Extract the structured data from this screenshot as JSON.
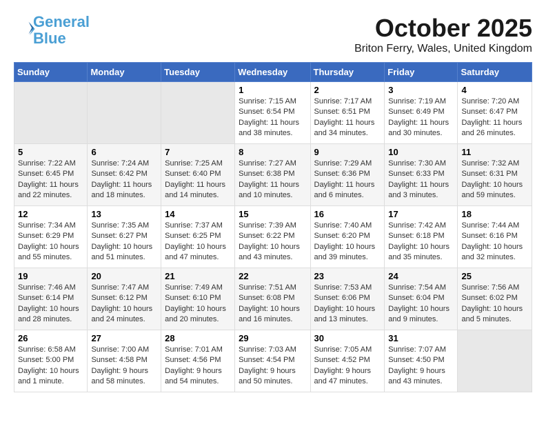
{
  "header": {
    "logo_line1": "General",
    "logo_line2": "Blue",
    "month": "October 2025",
    "location": "Briton Ferry, Wales, United Kingdom"
  },
  "days_of_week": [
    "Sunday",
    "Monday",
    "Tuesday",
    "Wednesday",
    "Thursday",
    "Friday",
    "Saturday"
  ],
  "weeks": [
    [
      {
        "day": "",
        "info": ""
      },
      {
        "day": "",
        "info": ""
      },
      {
        "day": "",
        "info": ""
      },
      {
        "day": "1",
        "info": "Sunrise: 7:15 AM\nSunset: 6:54 PM\nDaylight: 11 hours\nand 38 minutes."
      },
      {
        "day": "2",
        "info": "Sunrise: 7:17 AM\nSunset: 6:51 PM\nDaylight: 11 hours\nand 34 minutes."
      },
      {
        "day": "3",
        "info": "Sunrise: 7:19 AM\nSunset: 6:49 PM\nDaylight: 11 hours\nand 30 minutes."
      },
      {
        "day": "4",
        "info": "Sunrise: 7:20 AM\nSunset: 6:47 PM\nDaylight: 11 hours\nand 26 minutes."
      }
    ],
    [
      {
        "day": "5",
        "info": "Sunrise: 7:22 AM\nSunset: 6:45 PM\nDaylight: 11 hours\nand 22 minutes."
      },
      {
        "day": "6",
        "info": "Sunrise: 7:24 AM\nSunset: 6:42 PM\nDaylight: 11 hours\nand 18 minutes."
      },
      {
        "day": "7",
        "info": "Sunrise: 7:25 AM\nSunset: 6:40 PM\nDaylight: 11 hours\nand 14 minutes."
      },
      {
        "day": "8",
        "info": "Sunrise: 7:27 AM\nSunset: 6:38 PM\nDaylight: 11 hours\nand 10 minutes."
      },
      {
        "day": "9",
        "info": "Sunrise: 7:29 AM\nSunset: 6:36 PM\nDaylight: 11 hours\nand 6 minutes."
      },
      {
        "day": "10",
        "info": "Sunrise: 7:30 AM\nSunset: 6:33 PM\nDaylight: 11 hours\nand 3 minutes."
      },
      {
        "day": "11",
        "info": "Sunrise: 7:32 AM\nSunset: 6:31 PM\nDaylight: 10 hours\nand 59 minutes."
      }
    ],
    [
      {
        "day": "12",
        "info": "Sunrise: 7:34 AM\nSunset: 6:29 PM\nDaylight: 10 hours\nand 55 minutes."
      },
      {
        "day": "13",
        "info": "Sunrise: 7:35 AM\nSunset: 6:27 PM\nDaylight: 10 hours\nand 51 minutes."
      },
      {
        "day": "14",
        "info": "Sunrise: 7:37 AM\nSunset: 6:25 PM\nDaylight: 10 hours\nand 47 minutes."
      },
      {
        "day": "15",
        "info": "Sunrise: 7:39 AM\nSunset: 6:22 PM\nDaylight: 10 hours\nand 43 minutes."
      },
      {
        "day": "16",
        "info": "Sunrise: 7:40 AM\nSunset: 6:20 PM\nDaylight: 10 hours\nand 39 minutes."
      },
      {
        "day": "17",
        "info": "Sunrise: 7:42 AM\nSunset: 6:18 PM\nDaylight: 10 hours\nand 35 minutes."
      },
      {
        "day": "18",
        "info": "Sunrise: 7:44 AM\nSunset: 6:16 PM\nDaylight: 10 hours\nand 32 minutes."
      }
    ],
    [
      {
        "day": "19",
        "info": "Sunrise: 7:46 AM\nSunset: 6:14 PM\nDaylight: 10 hours\nand 28 minutes."
      },
      {
        "day": "20",
        "info": "Sunrise: 7:47 AM\nSunset: 6:12 PM\nDaylight: 10 hours\nand 24 minutes."
      },
      {
        "day": "21",
        "info": "Sunrise: 7:49 AM\nSunset: 6:10 PM\nDaylight: 10 hours\nand 20 minutes."
      },
      {
        "day": "22",
        "info": "Sunrise: 7:51 AM\nSunset: 6:08 PM\nDaylight: 10 hours\nand 16 minutes."
      },
      {
        "day": "23",
        "info": "Sunrise: 7:53 AM\nSunset: 6:06 PM\nDaylight: 10 hours\nand 13 minutes."
      },
      {
        "day": "24",
        "info": "Sunrise: 7:54 AM\nSunset: 6:04 PM\nDaylight: 10 hours\nand 9 minutes."
      },
      {
        "day": "25",
        "info": "Sunrise: 7:56 AM\nSunset: 6:02 PM\nDaylight: 10 hours\nand 5 minutes."
      }
    ],
    [
      {
        "day": "26",
        "info": "Sunrise: 6:58 AM\nSunset: 5:00 PM\nDaylight: 10 hours\nand 1 minute."
      },
      {
        "day": "27",
        "info": "Sunrise: 7:00 AM\nSunset: 4:58 PM\nDaylight: 9 hours\nand 58 minutes."
      },
      {
        "day": "28",
        "info": "Sunrise: 7:01 AM\nSunset: 4:56 PM\nDaylight: 9 hours\nand 54 minutes."
      },
      {
        "day": "29",
        "info": "Sunrise: 7:03 AM\nSunset: 4:54 PM\nDaylight: 9 hours\nand 50 minutes."
      },
      {
        "day": "30",
        "info": "Sunrise: 7:05 AM\nSunset: 4:52 PM\nDaylight: 9 hours\nand 47 minutes."
      },
      {
        "day": "31",
        "info": "Sunrise: 7:07 AM\nSunset: 4:50 PM\nDaylight: 9 hours\nand 43 minutes."
      },
      {
        "day": "",
        "info": ""
      }
    ]
  ]
}
